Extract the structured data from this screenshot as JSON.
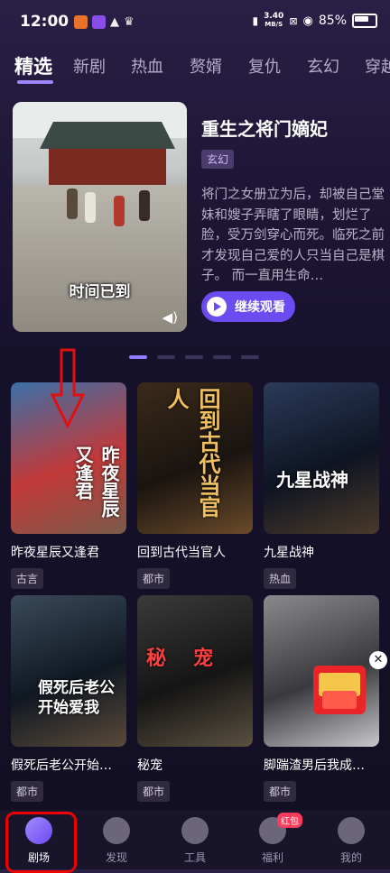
{
  "status": {
    "time": "12:00",
    "speed_top": "3.40",
    "speed_unit": "MB/S",
    "battery": "85%"
  },
  "tabs": [
    {
      "label": "精选",
      "active": true
    },
    {
      "label": "新剧"
    },
    {
      "label": "热血"
    },
    {
      "label": "赘婿"
    },
    {
      "label": "复仇"
    },
    {
      "label": "玄幻"
    },
    {
      "label": "穿越"
    }
  ],
  "banner": {
    "caption": "时间已到",
    "title": "重生之将门嫡妃",
    "tag": "玄幻",
    "description": "将门之女册立为后，却被自己堂妹和嫂子弄瞎了眼睛，划烂了脸，受万剑穿心而死。临死之前才发现自己爱的人只当自己是棋子。 而一直用生命…",
    "button": "继续观看"
  },
  "dramas": [
    {
      "name": "昨夜星辰又逢君",
      "tag": "古言",
      "poster_text": "昨夜星辰又逢君",
      "colors": [
        "#3a6fa8",
        "#c23a3a",
        "#7a5a4a"
      ]
    },
    {
      "name": "回到古代当官人",
      "tag": "都市",
      "poster_text": "回到古代当官人",
      "colors": [
        "#3a2a1a",
        "#1a1410",
        "#6a4a2a"
      ]
    },
    {
      "name": "九星战神",
      "tag": "热血",
      "poster_text": "九星战神",
      "colors": [
        "#2b3a5a",
        "#0e1422",
        "#4a3a2a"
      ]
    },
    {
      "name": "假死后老公开始…",
      "tag": "都市",
      "poster_text": "假死后老公开始爱我",
      "colors": [
        "#3a4a5a",
        "#101822",
        "#5a4a3a"
      ]
    },
    {
      "name": "秘宠",
      "tag": "都市",
      "poster_text": "秘宠",
      "colors": [
        "#3a3a3a",
        "#151515",
        "#5a5040"
      ]
    },
    {
      "name": "脚踹渣男后我成…",
      "tag": "都市",
      "poster_text": "",
      "colors": [
        "#8a8a8e",
        "#3a3a3e",
        "#c8c8cc"
      ]
    }
  ],
  "nav": [
    {
      "label": "剧场",
      "active": true
    },
    {
      "label": "发现"
    },
    {
      "label": "工具"
    },
    {
      "label": "福利",
      "badge": "红包"
    },
    {
      "label": "我的"
    }
  ],
  "close_symbol": "✕"
}
